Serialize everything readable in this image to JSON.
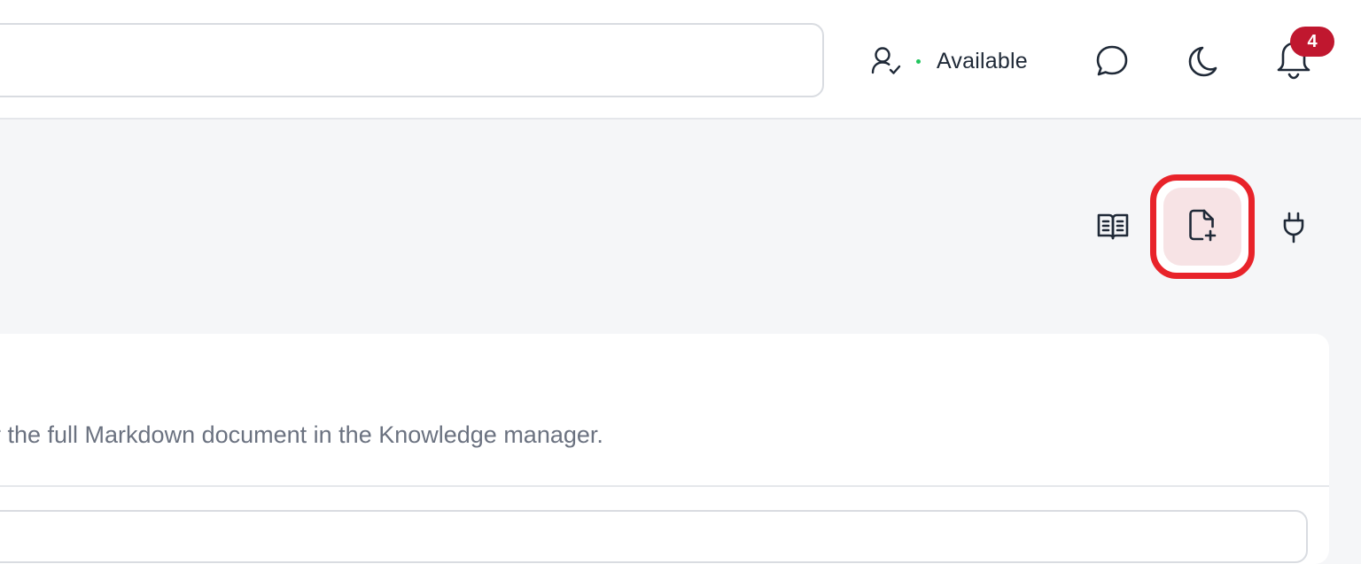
{
  "header": {
    "status": {
      "label": "Available",
      "dot_color": "#22c55e"
    },
    "icons": {
      "user": "user-check-icon",
      "chat": "message-circle-icon",
      "theme": "moon-icon",
      "notifications": "bell-icon"
    },
    "notification_count": "4",
    "badge_color": "#c0172f"
  },
  "toolbar": {
    "icons": [
      "book-open-icon",
      "file-plus-icon",
      "plug-icon"
    ],
    "highlight_color": "#e8232a"
  },
  "content": {
    "description": "r the full Markdown document in the Knowledge manager."
  }
}
